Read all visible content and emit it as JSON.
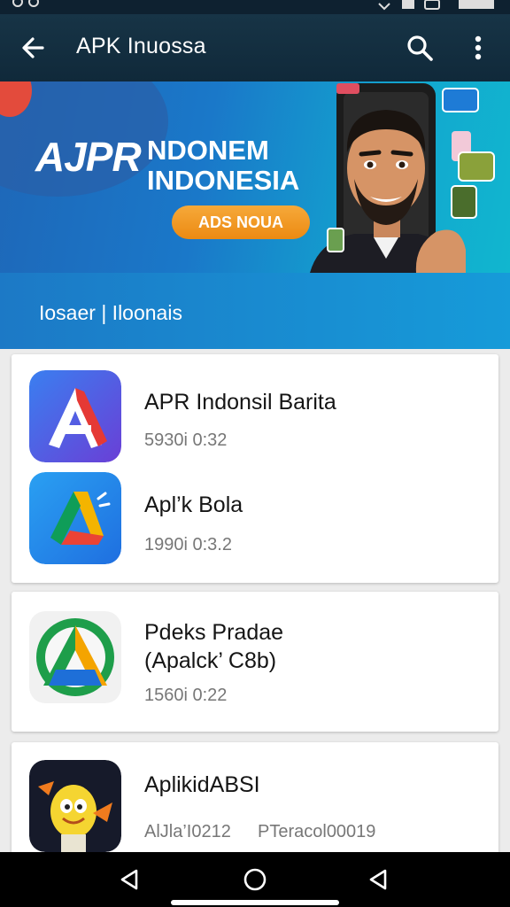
{
  "app_bar": {
    "title": "APK Inuossa",
    "back_icon": "arrow-back-icon",
    "search_icon": "search-icon",
    "more_icon": "more-vert-icon"
  },
  "banner": {
    "logo": "AJPR",
    "headline_1": "NDONEM",
    "headline_2": "INDONESIA",
    "cta_label": "ADS NOUA"
  },
  "subheader": {
    "text": "Iosaer | Iloonais"
  },
  "apps": [
    {
      "name": "APR Indonsil Barita",
      "meta": "5930i 0:32",
      "icon": "red-blue-a-icon"
    },
    {
      "name": "Apl’k Bola",
      "meta": "1990i 0:3.2",
      "icon": "drive-triangle-icon"
    },
    {
      "name": "Pdeks Pradae",
      "name_line2": "(Apalck’ C8b)",
      "meta": "1560i 0:22",
      "icon": "green-a-icon"
    },
    {
      "name": "AplikidABSI",
      "meta": "AlJla’I0212",
      "meta_right": "PTeracol00019",
      "icon": "cartoon-mascot-icon"
    }
  ],
  "nav_bar": {
    "back": "nav-back-icon",
    "home": "nav-home-icon",
    "recents": "nav-recents-icon"
  },
  "colors": {
    "app_bar": "#10293a",
    "banner": "#1a78c9",
    "cta": "#ec8a12",
    "subheader": "#169bd9"
  }
}
